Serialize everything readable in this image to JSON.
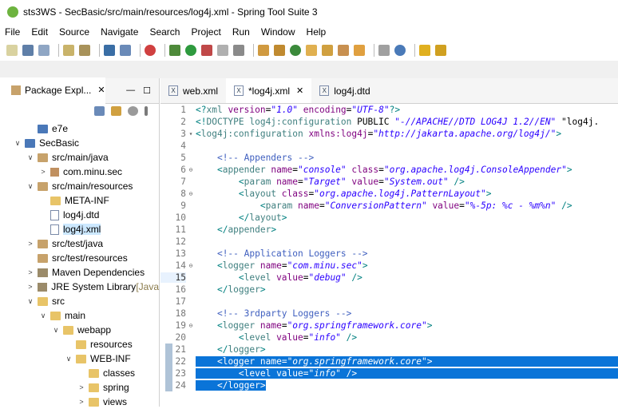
{
  "window": {
    "title": "sts3WS - SecBasic/src/main/resources/log4j.xml - Spring Tool Suite 3"
  },
  "menu": [
    "File",
    "Edit",
    "Source",
    "Navigate",
    "Search",
    "Project",
    "Run",
    "Window",
    "Help"
  ],
  "package_explorer": {
    "tab_label": "Package Expl...",
    "tree": [
      {
        "label": "e7e",
        "depth": 1,
        "arrow": "",
        "icon": "proj"
      },
      {
        "label": "SecBasic",
        "depth": 0,
        "arrow": "v",
        "icon": "proj"
      },
      {
        "label": "src/main/java",
        "depth": 1,
        "arrow": "v",
        "icon": "pfolder"
      },
      {
        "label": "com.minu.sec",
        "depth": 2,
        "arrow": ">",
        "icon": "pkgi"
      },
      {
        "label": "src/main/resources",
        "depth": 1,
        "arrow": "v",
        "icon": "pfolder"
      },
      {
        "label": "META-INF",
        "depth": 2,
        "arrow": "",
        "icon": "folder"
      },
      {
        "label": "log4j.dtd",
        "depth": 2,
        "arrow": "",
        "icon": "file"
      },
      {
        "label": "log4j.xml",
        "depth": 2,
        "arrow": "",
        "icon": "file",
        "selected": true
      },
      {
        "label": "src/test/java",
        "depth": 1,
        "arrow": ">",
        "icon": "pfolder"
      },
      {
        "label": "src/test/resources",
        "depth": 1,
        "arrow": "",
        "icon": "pfolder"
      },
      {
        "label": "Maven Dependencies",
        "depth": 1,
        "arrow": ">",
        "icon": "lib"
      },
      {
        "label": "JRE System Library",
        "depth": 1,
        "arrow": ">",
        "icon": "lib",
        "suffix": "[Java"
      },
      {
        "label": "src",
        "depth": 1,
        "arrow": "v",
        "icon": "folder"
      },
      {
        "label": "main",
        "depth": 2,
        "arrow": "v",
        "icon": "folder"
      },
      {
        "label": "webapp",
        "depth": 3,
        "arrow": "v",
        "icon": "folder"
      },
      {
        "label": "resources",
        "depth": 4,
        "arrow": "",
        "icon": "folder"
      },
      {
        "label": "WEB-INF",
        "depth": 4,
        "arrow": "v",
        "icon": "folder"
      },
      {
        "label": "classes",
        "depth": 5,
        "arrow": "",
        "icon": "folder"
      },
      {
        "label": "spring",
        "depth": 5,
        "arrow": ">",
        "icon": "folder"
      },
      {
        "label": "views",
        "depth": 5,
        "arrow": ">",
        "icon": "folder"
      }
    ]
  },
  "editor": {
    "tabs": [
      {
        "label": "web.xml",
        "active": false,
        "close": false
      },
      {
        "label": "*log4j.xml",
        "active": true,
        "close": true
      },
      {
        "label": "log4j.dtd",
        "active": false,
        "close": false
      }
    ],
    "lines": [
      {
        "n": "1",
        "fold": "",
        "hl": false,
        "parts": [
          [
            "pun",
            "<?"
          ],
          [
            "tag",
            "xml "
          ],
          [
            "att",
            "version"
          ],
          [
            "plain",
            "="
          ],
          [
            "val",
            "\"1.0\""
          ],
          [
            "plain",
            " "
          ],
          [
            "att",
            "encoding"
          ],
          [
            "plain",
            "="
          ],
          [
            "val",
            "\"UTF-8\""
          ],
          [
            "pun",
            "?>"
          ]
        ]
      },
      {
        "n": "2",
        "fold": "",
        "hl": false,
        "parts": [
          [
            "pun",
            "<!"
          ],
          [
            "tag",
            "DOCTYPE log4j:configuration "
          ],
          [
            "plain",
            "PUBLIC "
          ],
          [
            "val",
            "\"-//APACHE//DTD LOG4J 1.2//EN\""
          ],
          [
            "plain",
            " \"log4j."
          ]
        ]
      },
      {
        "n": "3",
        "fold": "▾",
        "hl": false,
        "parts": [
          [
            "pun",
            "<"
          ],
          [
            "tag",
            "log4j:configuration "
          ],
          [
            "att",
            "xmlns:log4j"
          ],
          [
            "plain",
            "="
          ],
          [
            "val",
            "\"http://jakarta.apache.org/log4j/\""
          ],
          [
            "pun",
            ">"
          ]
        ]
      },
      {
        "n": "4",
        "fold": "",
        "hl": false,
        "parts": []
      },
      {
        "n": "5",
        "fold": "",
        "hl": false,
        "parts": [
          [
            "plain",
            "    "
          ],
          [
            "cmt",
            "<!-- Appenders -->"
          ]
        ]
      },
      {
        "n": "6",
        "fold": "⊖",
        "hl": false,
        "parts": [
          [
            "plain",
            "    "
          ],
          [
            "pun",
            "<"
          ],
          [
            "tag",
            "appender "
          ],
          [
            "att",
            "name"
          ],
          [
            "plain",
            "="
          ],
          [
            "val",
            "\"console\""
          ],
          [
            "plain",
            " "
          ],
          [
            "att",
            "class"
          ],
          [
            "plain",
            "="
          ],
          [
            "val",
            "\"org.apache.log4j.ConsoleAppender\""
          ],
          [
            "pun",
            ">"
          ]
        ]
      },
      {
        "n": "7",
        "fold": "",
        "hl": false,
        "parts": [
          [
            "plain",
            "        "
          ],
          [
            "pun",
            "<"
          ],
          [
            "tag",
            "param "
          ],
          [
            "att",
            "name"
          ],
          [
            "plain",
            "="
          ],
          [
            "val",
            "\"Target\""
          ],
          [
            "plain",
            " "
          ],
          [
            "att",
            "value"
          ],
          [
            "plain",
            "="
          ],
          [
            "val",
            "\"System.out\""
          ],
          [
            "plain",
            " "
          ],
          [
            "pun",
            "/>"
          ]
        ]
      },
      {
        "n": "8",
        "fold": "⊖",
        "hl": false,
        "parts": [
          [
            "plain",
            "        "
          ],
          [
            "pun",
            "<"
          ],
          [
            "tag",
            "layout "
          ],
          [
            "att",
            "class"
          ],
          [
            "plain",
            "="
          ],
          [
            "val",
            "\"org.apache.log4j.PatternLayout\""
          ],
          [
            "pun",
            ">"
          ]
        ]
      },
      {
        "n": "9",
        "fold": "",
        "hl": false,
        "parts": [
          [
            "plain",
            "            "
          ],
          [
            "pun",
            "<"
          ],
          [
            "tag",
            "param "
          ],
          [
            "att",
            "name"
          ],
          [
            "plain",
            "="
          ],
          [
            "val",
            "\"ConversionPattern\""
          ],
          [
            "plain",
            " "
          ],
          [
            "att",
            "value"
          ],
          [
            "plain",
            "="
          ],
          [
            "val",
            "\"%-5p: %c - %m%n\""
          ],
          [
            "plain",
            " "
          ],
          [
            "pun",
            "/>"
          ]
        ]
      },
      {
        "n": "10",
        "fold": "",
        "hl": false,
        "parts": [
          [
            "plain",
            "        "
          ],
          [
            "pun",
            "</"
          ],
          [
            "tag",
            "layout"
          ],
          [
            "pun",
            ">"
          ]
        ]
      },
      {
        "n": "11",
        "fold": "",
        "hl": false,
        "parts": [
          [
            "plain",
            "    "
          ],
          [
            "pun",
            "</"
          ],
          [
            "tag",
            "appender"
          ],
          [
            "pun",
            ">"
          ]
        ]
      },
      {
        "n": "12",
        "fold": "",
        "hl": false,
        "parts": []
      },
      {
        "n": "13",
        "fold": "",
        "hl": false,
        "parts": [
          [
            "plain",
            "    "
          ],
          [
            "cmt",
            "<!-- Application Loggers -->"
          ]
        ]
      },
      {
        "n": "14",
        "fold": "⊖",
        "hl": false,
        "parts": [
          [
            "plain",
            "    "
          ],
          [
            "pun",
            "<"
          ],
          [
            "tag",
            "logger "
          ],
          [
            "att",
            "name"
          ],
          [
            "plain",
            "="
          ],
          [
            "val",
            "\"com.minu.sec\""
          ],
          [
            "pun",
            ">"
          ]
        ]
      },
      {
        "n": "15",
        "fold": "",
        "hl": false,
        "cur": true,
        "parts": [
          [
            "plain",
            "        "
          ],
          [
            "pun",
            "<"
          ],
          [
            "tag",
            "level "
          ],
          [
            "att",
            "value"
          ],
          [
            "plain",
            "="
          ],
          [
            "val",
            "\"debug\""
          ],
          [
            "plain",
            " "
          ],
          [
            "pun",
            "/>"
          ]
        ]
      },
      {
        "n": "16",
        "fold": "",
        "hl": false,
        "parts": [
          [
            "plain",
            "    "
          ],
          [
            "pun",
            "</"
          ],
          [
            "tag",
            "logger"
          ],
          [
            "pun",
            ">"
          ]
        ]
      },
      {
        "n": "17",
        "fold": "",
        "hl": false,
        "parts": []
      },
      {
        "n": "18",
        "fold": "",
        "hl": false,
        "parts": [
          [
            "plain",
            "    "
          ],
          [
            "cmt",
            "<!-- 3rdparty Loggers -->"
          ]
        ]
      },
      {
        "n": "19",
        "fold": "⊖",
        "hl": false,
        "parts": [
          [
            "plain",
            "    "
          ],
          [
            "pun",
            "<"
          ],
          [
            "tag",
            "logger "
          ],
          [
            "att",
            "name"
          ],
          [
            "plain",
            "="
          ],
          [
            "val",
            "\"org.springframework.core\""
          ],
          [
            "pun",
            ">"
          ]
        ]
      },
      {
        "n": "20",
        "fold": "",
        "hl": false,
        "parts": [
          [
            "plain",
            "        "
          ],
          [
            "pun",
            "<"
          ],
          [
            "tag",
            "level "
          ],
          [
            "att",
            "value"
          ],
          [
            "plain",
            "="
          ],
          [
            "val",
            "\"info\""
          ],
          [
            "plain",
            " "
          ],
          [
            "pun",
            "/>"
          ]
        ]
      },
      {
        "n": "21",
        "fold": "",
        "hl": false,
        "mark": true,
        "parts": [
          [
            "plain",
            "    "
          ],
          [
            "pun",
            "</"
          ],
          [
            "tag",
            "logger"
          ],
          [
            "pun",
            ">"
          ]
        ]
      },
      {
        "n": "22",
        "fold": "",
        "hl": true,
        "mark": true,
        "parts": [
          [
            "plain",
            "    "
          ],
          [
            "pun",
            "<"
          ],
          [
            "tag",
            "logger "
          ],
          [
            "att",
            "name"
          ],
          [
            "plain",
            "="
          ],
          [
            "val",
            "\"org.springframework.core\""
          ],
          [
            "pun",
            ">"
          ]
        ]
      },
      {
        "n": "23",
        "fold": "",
        "hl": true,
        "mark": true,
        "parts": [
          [
            "plain",
            "        "
          ],
          [
            "pun",
            "<"
          ],
          [
            "tag",
            "level "
          ],
          [
            "att",
            "value"
          ],
          [
            "plain",
            "="
          ],
          [
            "val",
            "\"info\""
          ],
          [
            "plain",
            " "
          ],
          [
            "pun",
            "/>"
          ]
        ]
      },
      {
        "n": "24",
        "fold": "",
        "hl": true,
        "mark": true,
        "partial": true,
        "parts": [
          [
            "plain",
            "    "
          ],
          [
            "pun",
            "</"
          ],
          [
            "tag",
            "logger"
          ],
          [
            "pun",
            ">"
          ]
        ]
      }
    ]
  }
}
